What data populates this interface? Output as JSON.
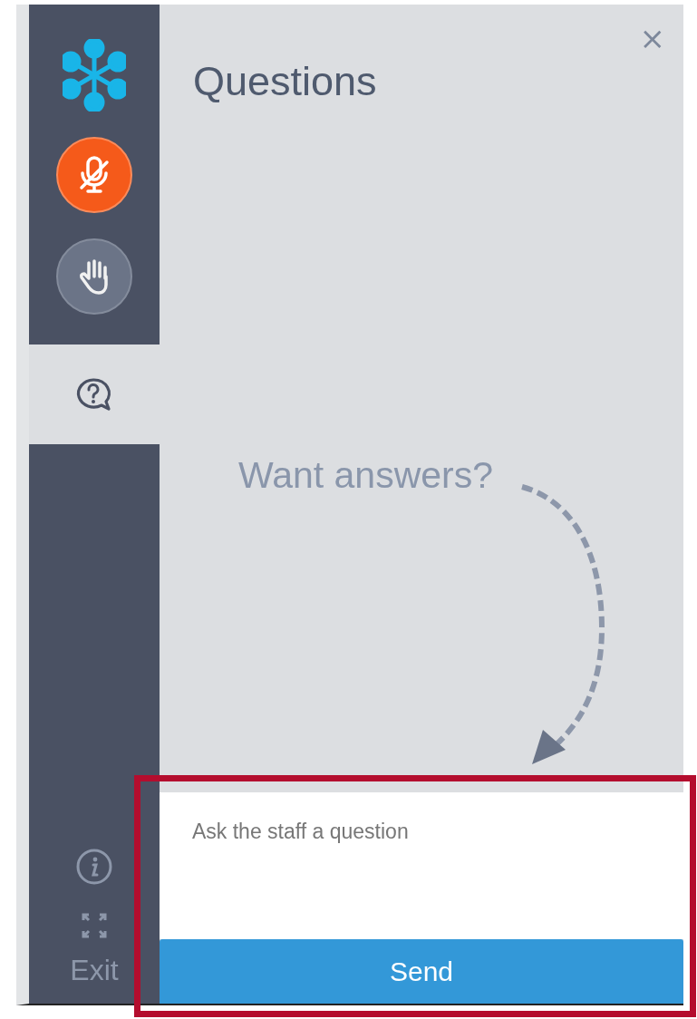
{
  "sidebar": {
    "mic": {
      "muted": true
    },
    "hand": {
      "raised": false
    },
    "nav": [
      {
        "kind": "questions",
        "selected": true
      }
    ],
    "exit": "Exit"
  },
  "panel": {
    "title": "Questions",
    "close": "×",
    "prompt": "Want answers?"
  },
  "composer": {
    "placeholder": "Ask the staff a question",
    "button": "Send"
  }
}
